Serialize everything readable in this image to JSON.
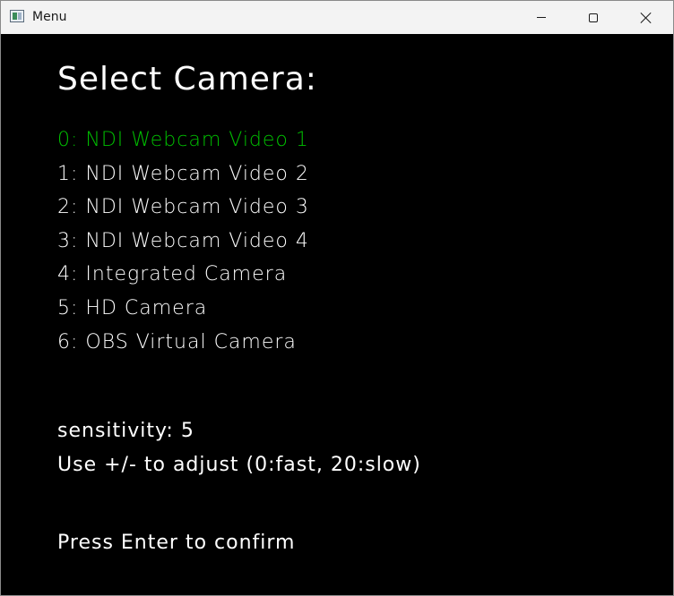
{
  "window": {
    "title": "Menu",
    "icon": "app-window-icon"
  },
  "menu": {
    "heading": "Select Camera:",
    "selected_index": 0,
    "selected_color": "#00c000",
    "cameras": [
      "0: NDI Webcam Video 1",
      "1: NDI Webcam Video 2",
      "2: NDI Webcam Video 3",
      "3: NDI Webcam Video 4",
      "4: Integrated Camera",
      "5: HD Camera",
      "6: OBS Virtual Camera"
    ],
    "sensitivity_text": "sensitivity: 5",
    "adjust_hint": "Use +/- to adjust (0:fast, 20:slow)",
    "confirm_text": "Press Enter to confirm"
  }
}
